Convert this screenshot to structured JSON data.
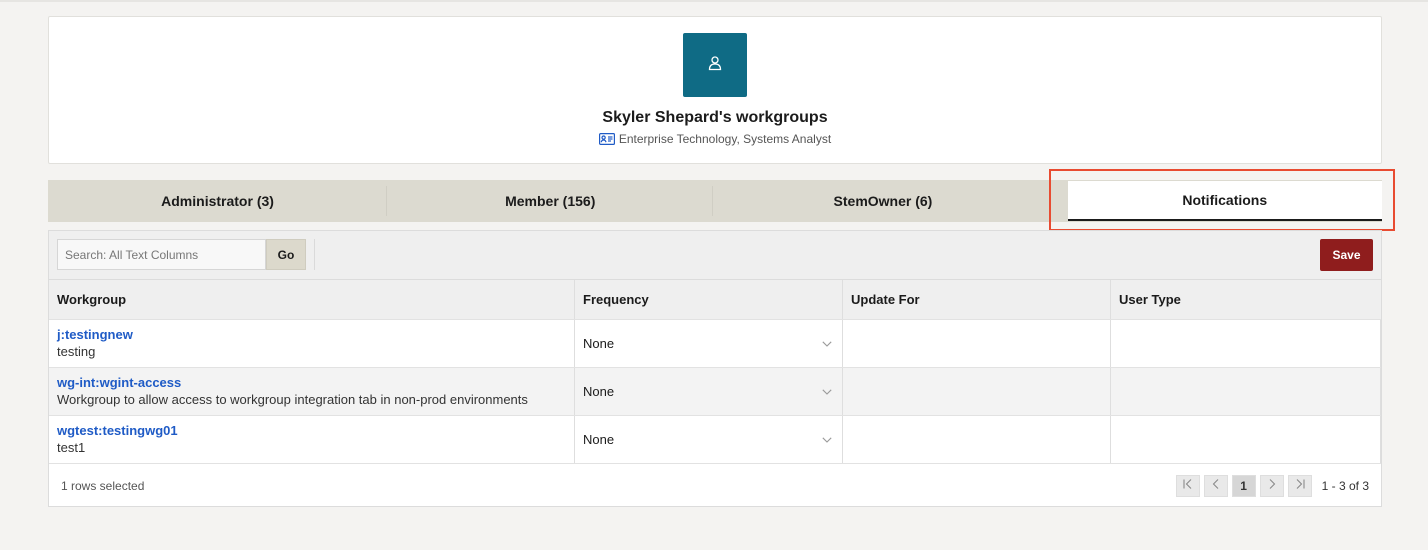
{
  "profile": {
    "title": "Skyler Shepard's workgroups",
    "subtitle": "Enterprise Technology, Systems Analyst",
    "avatar_color": "#0f6b85"
  },
  "tabs": [
    {
      "label": "Administrator (3)",
      "active": false
    },
    {
      "label": "Member (156)",
      "active": false
    },
    {
      "label": "StemOwner (6)",
      "active": false
    },
    {
      "label": "Notifications",
      "active": true
    }
  ],
  "toolbar": {
    "search_placeholder": "Search: All Text Columns",
    "go_label": "Go",
    "save_label": "Save",
    "save_color": "#8f1d1d"
  },
  "table": {
    "headers": [
      "Workgroup",
      "Frequency",
      "Update For",
      "User Type"
    ],
    "rows": [
      {
        "workgroup": "j:testingnew",
        "description": "testing",
        "frequency": "None",
        "update_for": "",
        "user_type": ""
      },
      {
        "workgroup": "wg-int:wgint-access",
        "description": "Workgroup to allow access to workgroup integration tab in non-prod environments",
        "frequency": "None",
        "update_for": "",
        "user_type": ""
      },
      {
        "workgroup": "wgtest:testingwg01",
        "description": "test1",
        "frequency": "None",
        "update_for": "",
        "user_type": ""
      }
    ]
  },
  "footer": {
    "rows_selected": "1 rows selected",
    "current_page": "1",
    "range": "1 - 3 of 3"
  },
  "colors": {
    "link": "#1f5bc6",
    "highlight": "#e84b31"
  }
}
